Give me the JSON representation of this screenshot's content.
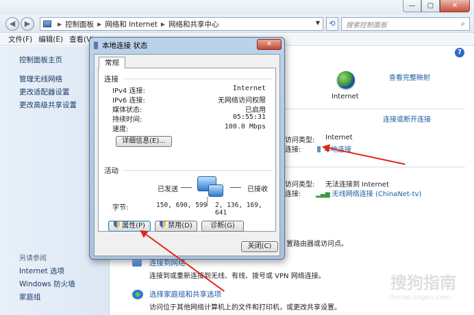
{
  "window": {
    "controls": {
      "minimize": "—",
      "maximize": "▢",
      "close": "✕"
    }
  },
  "address": {
    "crumbs": [
      "控制面板",
      "网络和 Internet",
      "网络和共享中心"
    ],
    "search_placeholder": "搜索控制面板"
  },
  "menu": [
    "文件(F)",
    "编辑(E)",
    "查看(V)"
  ],
  "sidebar": {
    "items": [
      "控制面板主页",
      "管理无线网络",
      "更改适配器设置",
      "更改高级共享设置"
    ],
    "see_also": "另请参阅",
    "see_also_items": [
      "Internet 选项",
      "Windows 防火墙",
      "家庭组"
    ]
  },
  "main": {
    "view_full_map": "查看完整映射",
    "internet_label": "Internet",
    "connect_disconnect": "连接或断开连接",
    "net1": {
      "access_type_label": "访问类型:",
      "access_type": "Internet",
      "conn_label": "连接:",
      "conn": "本地连接"
    },
    "net2": {
      "access_type_label": "访问类型:",
      "access_type": "无法连接到 Internet",
      "conn_label": "连接:",
      "conn": "无线网络连接 (ChinaNet-tv)"
    },
    "router_text": "置路由器或访问点。",
    "task1_title": "连接到网络",
    "task1_desc": "连接到或重新连接到无线、有线、拨号或 VPN 网络连接。",
    "task2_title": "选择家庭组和共享选项",
    "task2_desc": "访问位于其他网络计算机上的文件和打印机，或更改共享设置。"
  },
  "dialog": {
    "title": "本地连接 状态",
    "close": "✕",
    "tab": "常规",
    "conn_group": "连接",
    "rows": [
      {
        "label": "IPv4 连接:",
        "value": "Internet"
      },
      {
        "label": "IPv6 连接:",
        "value": "无网络访问权限"
      },
      {
        "label": "媒体状态:",
        "value": "已启用"
      },
      {
        "label": "持续时间:",
        "value": "05:55:31"
      },
      {
        "label": "速度:",
        "value": "100.0 Mbps"
      }
    ],
    "details_btn": "详细信息(E)...",
    "activity_group": "活动",
    "sent_label": "已发送",
    "recv_label": "已接收",
    "bytes_label": "字节:",
    "bytes_sent": "150, 690, 599",
    "bytes_recv": "2, 136, 169, 641",
    "properties_btn": "属性(P)",
    "disable_btn": "禁用(D)",
    "diagnose_btn": "诊断(G)",
    "close_btn": "关闭(C)"
  },
  "watermark": {
    "text": "搜狗指南",
    "url": "zhinan.sogou.com"
  },
  "colors": {
    "accent": "#1a5aa3",
    "arrow": "#e1251b"
  }
}
